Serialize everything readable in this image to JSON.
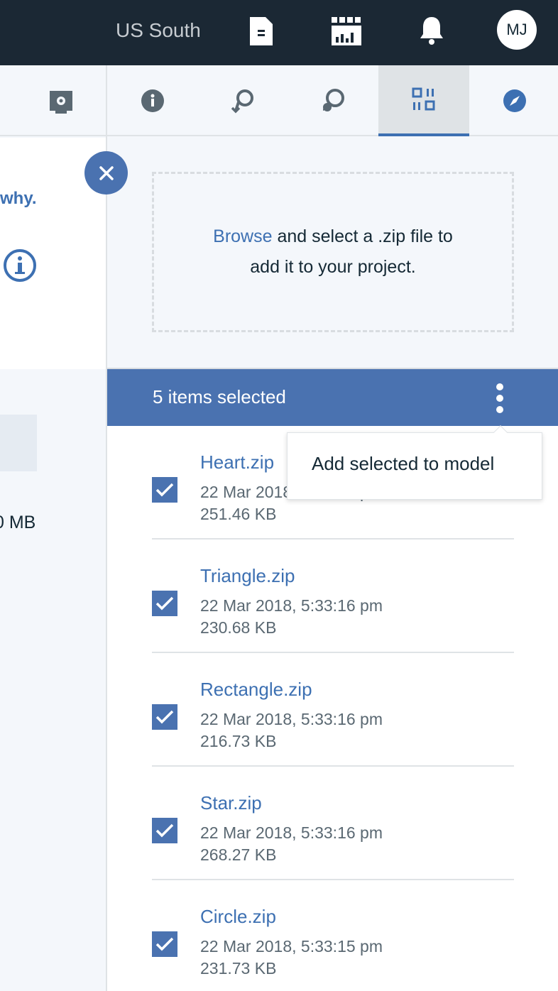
{
  "topbar": {
    "region": "US South",
    "avatar_initials": "MJ"
  },
  "left_panel": {
    "why_text": "why.",
    "size_text": "0 MB"
  },
  "tabs": [
    {
      "icon": "info-icon",
      "active": false
    },
    {
      "icon": "search-back-icon",
      "active": false
    },
    {
      "icon": "chat-icon",
      "active": false
    },
    {
      "icon": "data-assets-icon",
      "active": true
    },
    {
      "icon": "compass-icon",
      "active": false
    }
  ],
  "dropzone": {
    "browse_label": "Browse",
    "text_rest": " and select a .zip file to",
    "text_line2": "add it to your project."
  },
  "selection": {
    "label": "5 items selected"
  },
  "menu": {
    "item": "Add selected to model"
  },
  "files": [
    {
      "name": "Heart.zip",
      "date": "22 Mar 2018, 5:33:16 pm",
      "size": "251.46 KB",
      "checked": true
    },
    {
      "name": "Triangle.zip",
      "date": "22 Mar 2018, 5:33:16 pm",
      "size": "230.68 KB",
      "checked": true
    },
    {
      "name": "Rectangle.zip",
      "date": "22 Mar 2018, 5:33:16 pm",
      "size": "216.73 KB",
      "checked": true
    },
    {
      "name": "Star.zip",
      "date": "22 Mar 2018, 5:33:16 pm",
      "size": "268.27 KB",
      "checked": true
    },
    {
      "name": "Circle.zip",
      "date": "22 Mar 2018, 5:33:15 pm",
      "size": "231.73 KB",
      "checked": true
    }
  ],
  "colors": {
    "topbar": "#1b2834",
    "accent": "#4a72b0",
    "link": "#3d70b2"
  }
}
